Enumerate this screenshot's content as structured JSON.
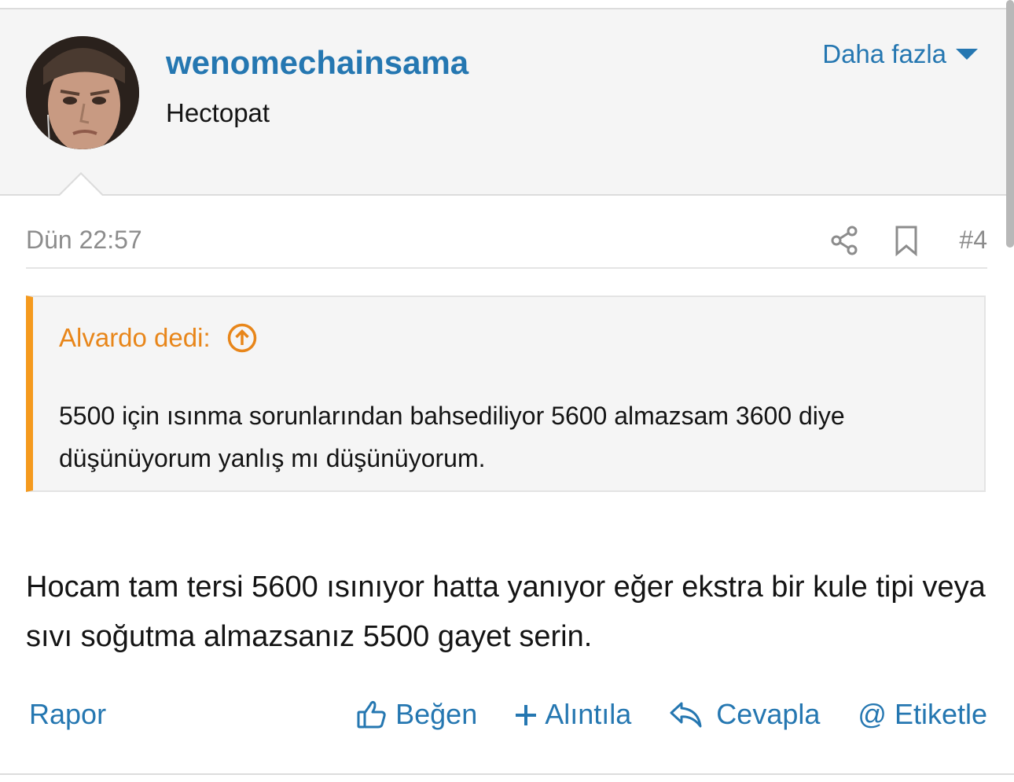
{
  "post": {
    "username": "wenomechainsama",
    "user_title": "Hectopat",
    "more_label": "Daha fazla",
    "date": "Dün 22:57",
    "post_number": "#4",
    "quote": {
      "author": "Alvardo dedi:",
      "text": "5500 için ısınma sorunlarından bahsediliyor 5600 almazsam 3600 diye düşünüyorum yanlış mı düşünüyorum."
    },
    "message": "Hocam tam tersi 5600 ısınıyor hatta yanıyor eğer ekstra bir kule tipi veya sıvı soğutma almazsanız 5500 gayet serin.",
    "actions": {
      "report": "Rapor",
      "like": "Beğen",
      "quote": "Alıntıla",
      "reply": "Cevapla",
      "mention": "Etiketle"
    }
  },
  "colors": {
    "link": "#2577b1",
    "quote_accent": "#f59a1e",
    "header_bg": "#f5f5f5"
  },
  "icons": [
    "caret-down-icon",
    "share-icon",
    "bookmark-icon",
    "arrow-up-circle-icon",
    "thumbs-up-icon",
    "plus-icon",
    "reply-icon",
    "at-icon"
  ]
}
